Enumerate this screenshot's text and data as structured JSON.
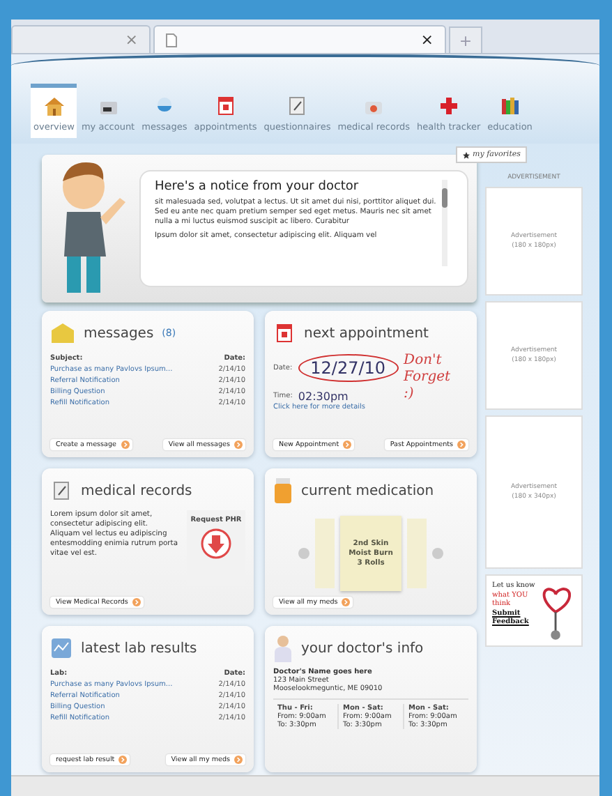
{
  "browser": {
    "tabs": [
      {
        "close": "×",
        "selected": false
      },
      {
        "close": "×",
        "selected": true
      }
    ],
    "new_tab": "+"
  },
  "nav": {
    "items": [
      {
        "label": "overview",
        "kind": "house",
        "selected": true
      },
      {
        "label": "my account",
        "kind": "account",
        "selected": false
      },
      {
        "label": "messages",
        "kind": "bowl",
        "selected": false
      },
      {
        "label": "appointments",
        "kind": "calendar",
        "selected": false
      },
      {
        "label": "questionnaires",
        "kind": "clipboard",
        "selected": false
      },
      {
        "label": "medical records",
        "kind": "records",
        "selected": false
      },
      {
        "label": "health tracker",
        "kind": "cross",
        "selected": false
      },
      {
        "label": "education",
        "kind": "books",
        "selected": false
      }
    ]
  },
  "notice": {
    "title": "Here's a notice from your doctor",
    "paragraphs": [
      "sit malesuada sed, volutpat a lectus. Ut sit amet dui nisi, porttitor aliquet dui. Sed eu ante nec quam pretium semper sed eget metus. Mauris nec sit amet nulla a mi luctus euismod suscipit ac libero. Curabitur",
      "Ipsum dolor sit amet, consectetur adipiscing elit. Aliquam vel"
    ]
  },
  "favorites": {
    "label": "my favorites"
  },
  "messages": {
    "title": "messages",
    "count": "(8)",
    "columns": [
      "Subject:",
      "Date:"
    ],
    "rows": [
      [
        "Purchase as many Pavlovs Ipsum...",
        "2/14/10"
      ],
      [
        "Referral Notification",
        "2/14/10"
      ],
      [
        "Billing Question",
        "2/14/10"
      ],
      [
        "Refill Notification",
        "2/14/10"
      ]
    ],
    "buttons": [
      "Create a message",
      "View all messages"
    ]
  },
  "appointment": {
    "title": "next appointment",
    "date_label": "Date:",
    "date": "12/27/10",
    "time_label": "Time:",
    "time": "02:30pm",
    "note": "Don't Forget :)",
    "link": "Click here for more details",
    "buttons": [
      "New Appointment",
      "Past Appointments"
    ]
  },
  "medical_records": {
    "title": "medical records",
    "text": "Lorem ipsum dolor sit amet, consectetur adipiscing elit. Aliquam vel lectus eu adipiscing entesmodding enimia rutrum porta vitae vel est.",
    "request": "Request PHR",
    "buttons": [
      "View Medical Records"
    ]
  },
  "medication": {
    "title": "current medication",
    "card": [
      "2nd Skin",
      "Moist Burn",
      "3 Rolls"
    ],
    "buttons": [
      "View all my meds"
    ]
  },
  "lab_results": {
    "title": "latest lab results",
    "columns": [
      "Lab:",
      "Date:"
    ],
    "rows": [
      [
        "Purchase as many Pavlovs Ipsum...",
        "2/14/10"
      ],
      [
        "Referral Notification",
        "2/14/10"
      ],
      [
        "Billing Question",
        "2/14/10"
      ],
      [
        "Refill Notification",
        "2/14/10"
      ]
    ],
    "buttons": [
      "request lab result",
      "View all my meds"
    ]
  },
  "doctor": {
    "title": "your doctor's info",
    "lines": [
      "Doctor's Name goes here",
      "123 Main Street",
      "Mooselookmeguntic, ME 09010"
    ],
    "hours": [
      {
        "days": "Thu - Fri:",
        "from": "From: 9:00am",
        "to": "To: 3:30pm"
      },
      {
        "days": "Mon - Sat:",
        "from": "From: 9:00am",
        "to": "To: 3:30pm"
      },
      {
        "days": "Mon - Sat:",
        "from": "From: 9:00am",
        "to": "To: 3:30pm"
      }
    ]
  },
  "ads": {
    "label": "ADVERTISEMENT",
    "boxes": [
      {
        "text": "Advertisement",
        "size": "(180 x 180px)",
        "kind": "square"
      },
      {
        "text": "Advertisement",
        "size": "(180 x 180px)",
        "kind": "square"
      },
      {
        "text": "Advertisement",
        "size": "(180 x 340px)",
        "kind": "tall"
      }
    ],
    "promo": {
      "lead": "Let us know",
      "highlight": "what YOU think",
      "link": "Submit Feedback"
    }
  }
}
